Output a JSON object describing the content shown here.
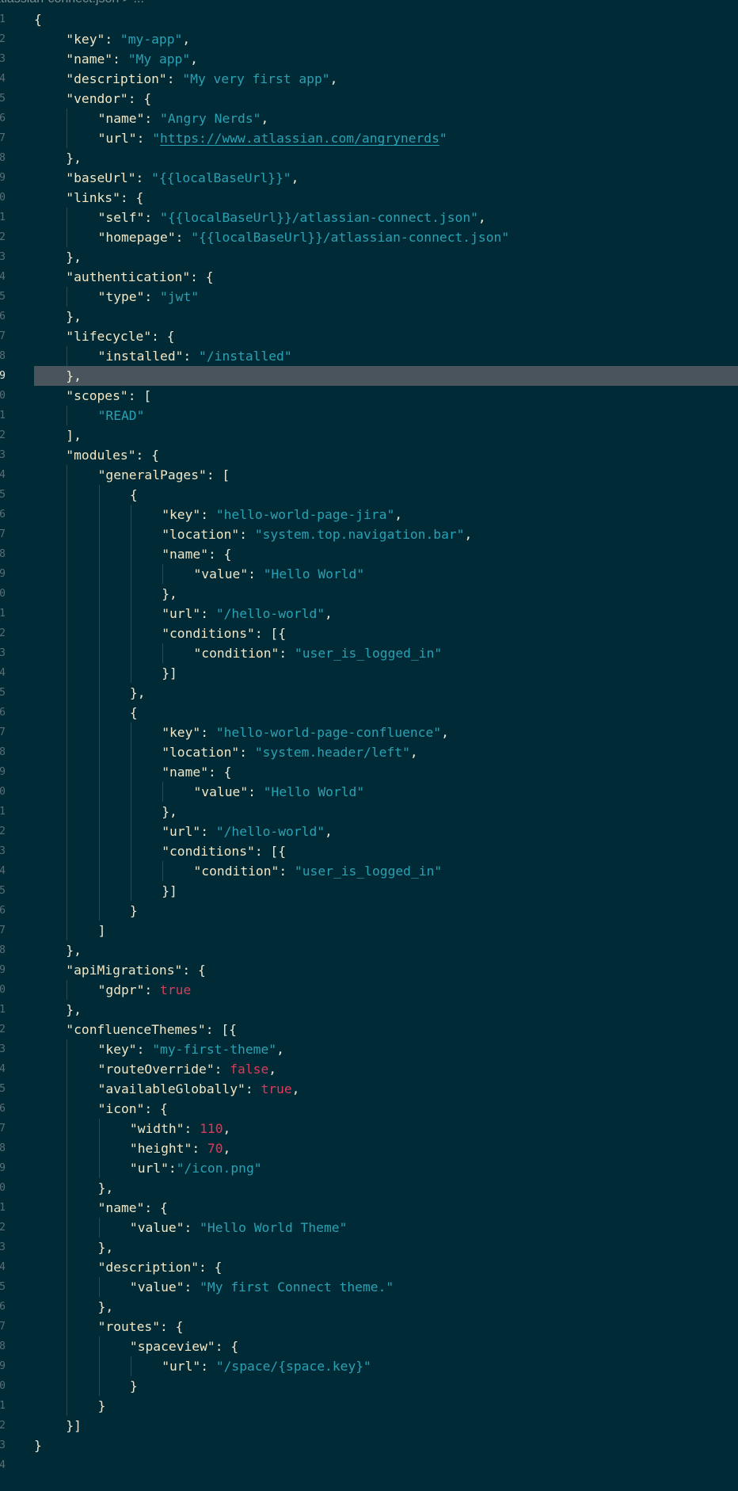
{
  "breadcrumb": "atlassian-connect.json > ...",
  "active_line": 19,
  "lines": [
    [
      [
        "p",
        "{"
      ]
    ],
    [
      [
        "k",
        "\"key\""
      ],
      [
        "p",
        ": "
      ],
      [
        "s",
        "\"my-app\""
      ],
      [
        "p",
        ","
      ]
    ],
    [
      [
        "k",
        "\"name\""
      ],
      [
        "p",
        ": "
      ],
      [
        "s",
        "\"My app\""
      ],
      [
        "p",
        ","
      ]
    ],
    [
      [
        "k",
        "\"description\""
      ],
      [
        "p",
        ": "
      ],
      [
        "s",
        "\"My very first app\""
      ],
      [
        "p",
        ","
      ]
    ],
    [
      [
        "k",
        "\"vendor\""
      ],
      [
        "p",
        ": {"
      ]
    ],
    [
      [
        "k",
        "\"name\""
      ],
      [
        "p",
        ": "
      ],
      [
        "s",
        "\"Angry Nerds\""
      ],
      [
        "p",
        ","
      ]
    ],
    [
      [
        "k",
        "\"url\""
      ],
      [
        "p",
        ": "
      ],
      [
        "s",
        "\""
      ],
      [
        "u",
        "https://www.atlassian.com/angrynerds"
      ],
      [
        "s",
        "\""
      ]
    ],
    [
      [
        "p",
        "},"
      ]
    ],
    [
      [
        "k",
        "\"baseUrl\""
      ],
      [
        "p",
        ": "
      ],
      [
        "s",
        "\"{{localBaseUrl}}\""
      ],
      [
        "p",
        ","
      ]
    ],
    [
      [
        "k",
        "\"links\""
      ],
      [
        "p",
        ": {"
      ]
    ],
    [
      [
        "k",
        "\"self\""
      ],
      [
        "p",
        ": "
      ],
      [
        "s",
        "\"{{localBaseUrl}}/atlassian-connect.json\""
      ],
      [
        "p",
        ","
      ]
    ],
    [
      [
        "k",
        "\"homepage\""
      ],
      [
        "p",
        ": "
      ],
      [
        "s",
        "\"{{localBaseUrl}}/atlassian-connect.json\""
      ]
    ],
    [
      [
        "p",
        "},"
      ]
    ],
    [
      [
        "k",
        "\"authentication\""
      ],
      [
        "p",
        ": {"
      ]
    ],
    [
      [
        "k",
        "\"type\""
      ],
      [
        "p",
        ": "
      ],
      [
        "s",
        "\"jwt\""
      ]
    ],
    [
      [
        "p",
        "},"
      ]
    ],
    [
      [
        "k",
        "\"lifecycle\""
      ],
      [
        "p",
        ": {"
      ]
    ],
    [
      [
        "k",
        "\"installed\""
      ],
      [
        "p",
        ": "
      ],
      [
        "s",
        "\"/installed\""
      ]
    ],
    [
      [
        "p",
        "},"
      ]
    ],
    [
      [
        "k",
        "\"scopes\""
      ],
      [
        "p",
        ": ["
      ]
    ],
    [
      [
        "s",
        "\"READ\""
      ]
    ],
    [
      [
        "p",
        "],"
      ]
    ],
    [
      [
        "k",
        "\"modules\""
      ],
      [
        "p",
        ": {"
      ]
    ],
    [
      [
        "k",
        "\"generalPages\""
      ],
      [
        "p",
        ": ["
      ]
    ],
    [
      [
        "p",
        "{"
      ]
    ],
    [
      [
        "k",
        "\"key\""
      ],
      [
        "p",
        ": "
      ],
      [
        "s",
        "\"hello-world-page-jira\""
      ],
      [
        "p",
        ","
      ]
    ],
    [
      [
        "k",
        "\"location\""
      ],
      [
        "p",
        ": "
      ],
      [
        "s",
        "\"system.top.navigation.bar\""
      ],
      [
        "p",
        ","
      ]
    ],
    [
      [
        "k",
        "\"name\""
      ],
      [
        "p",
        ": {"
      ]
    ],
    [
      [
        "k",
        "\"value\""
      ],
      [
        "p",
        ": "
      ],
      [
        "s",
        "\"Hello World\""
      ]
    ],
    [
      [
        "p",
        "},"
      ]
    ],
    [
      [
        "k",
        "\"url\""
      ],
      [
        "p",
        ": "
      ],
      [
        "s",
        "\"/hello-world\""
      ],
      [
        "p",
        ","
      ]
    ],
    [
      [
        "k",
        "\"conditions\""
      ],
      [
        "p",
        ": [{"
      ]
    ],
    [
      [
        "k",
        "\"condition\""
      ],
      [
        "p",
        ": "
      ],
      [
        "s",
        "\"user_is_logged_in\""
      ]
    ],
    [
      [
        "p",
        "}]"
      ]
    ],
    [
      [
        "p",
        "},"
      ]
    ],
    [
      [
        "p",
        "{"
      ]
    ],
    [
      [
        "k",
        "\"key\""
      ],
      [
        "p",
        ": "
      ],
      [
        "s",
        "\"hello-world-page-confluence\""
      ],
      [
        "p",
        ","
      ]
    ],
    [
      [
        "k",
        "\"location\""
      ],
      [
        "p",
        ": "
      ],
      [
        "s",
        "\"system.header/left\""
      ],
      [
        "p",
        ","
      ]
    ],
    [
      [
        "k",
        "\"name\""
      ],
      [
        "p",
        ": {"
      ]
    ],
    [
      [
        "k",
        "\"value\""
      ],
      [
        "p",
        ": "
      ],
      [
        "s",
        "\"Hello World\""
      ]
    ],
    [
      [
        "p",
        "},"
      ]
    ],
    [
      [
        "k",
        "\"url\""
      ],
      [
        "p",
        ": "
      ],
      [
        "s",
        "\"/hello-world\""
      ],
      [
        "p",
        ","
      ]
    ],
    [
      [
        "k",
        "\"conditions\""
      ],
      [
        "p",
        ": [{"
      ]
    ],
    [
      [
        "k",
        "\"condition\""
      ],
      [
        "p",
        ": "
      ],
      [
        "s",
        "\"user_is_logged_in\""
      ]
    ],
    [
      [
        "p",
        "}]"
      ]
    ],
    [
      [
        "p",
        "}"
      ]
    ],
    [
      [
        "p",
        "]"
      ]
    ],
    [
      [
        "p",
        "},"
      ]
    ],
    [
      [
        "k",
        "\"apiMigrations\""
      ],
      [
        "p",
        ": {"
      ]
    ],
    [
      [
        "k",
        "\"gdpr\""
      ],
      [
        "p",
        ": "
      ],
      [
        "n",
        "true"
      ]
    ],
    [
      [
        "p",
        "},"
      ]
    ],
    [
      [
        "k",
        "\"confluenceThemes\""
      ],
      [
        "p",
        ": [{"
      ]
    ],
    [
      [
        "k",
        "\"key\""
      ],
      [
        "p",
        ": "
      ],
      [
        "s",
        "\"my-first-theme\""
      ],
      [
        "p",
        ","
      ]
    ],
    [
      [
        "k",
        "\"routeOverride\""
      ],
      [
        "p",
        ": "
      ],
      [
        "n",
        "false"
      ],
      [
        "p",
        ","
      ]
    ],
    [
      [
        "k",
        "\"availableGlobally\""
      ],
      [
        "p",
        ": "
      ],
      [
        "n",
        "true"
      ],
      [
        "p",
        ","
      ]
    ],
    [
      [
        "k",
        "\"icon\""
      ],
      [
        "p",
        ": {"
      ]
    ],
    [
      [
        "k",
        "\"width\""
      ],
      [
        "p",
        ": "
      ],
      [
        "n",
        "110"
      ],
      [
        "p",
        ","
      ]
    ],
    [
      [
        "k",
        "\"height\""
      ],
      [
        "p",
        ": "
      ],
      [
        "n",
        "70"
      ],
      [
        "p",
        ","
      ]
    ],
    [
      [
        "k",
        "\"url\""
      ],
      [
        "p",
        ":"
      ],
      [
        "s",
        "\"/icon.png\""
      ]
    ],
    [
      [
        "p",
        "},"
      ]
    ],
    [
      [
        "k",
        "\"name\""
      ],
      [
        "p",
        ": {"
      ]
    ],
    [
      [
        "k",
        "\"value\""
      ],
      [
        "p",
        ": "
      ],
      [
        "s",
        "\"Hello World Theme\""
      ]
    ],
    [
      [
        "p",
        "},"
      ]
    ],
    [
      [
        "k",
        "\"description\""
      ],
      [
        "p",
        ": {"
      ]
    ],
    [
      [
        "k",
        "\"value\""
      ],
      [
        "p",
        ": "
      ],
      [
        "s",
        "\"My first Connect theme.\""
      ]
    ],
    [
      [
        "p",
        "},"
      ]
    ],
    [
      [
        "k",
        "\"routes\""
      ],
      [
        "p",
        ": {"
      ]
    ],
    [
      [
        "k",
        "\"spaceview\""
      ],
      [
        "p",
        ": {"
      ]
    ],
    [
      [
        "k",
        "\"url\""
      ],
      [
        "p",
        ": "
      ],
      [
        "s",
        "\"/space/{space.key}\""
      ]
    ],
    [
      [
        "p",
        "}"
      ]
    ],
    [
      [
        "p",
        "}"
      ]
    ],
    [
      [
        "p",
        "}]"
      ]
    ],
    [
      [
        "p",
        "}"
      ]
    ],
    []
  ],
  "line_number_digits": [
    "1",
    "2",
    "3",
    "4",
    "5",
    "6",
    "7",
    "8",
    "9",
    "0",
    "1",
    "2",
    "3",
    "4",
    "5",
    "6",
    "7",
    "8",
    "9",
    "0",
    "1",
    "2",
    "3",
    "4",
    "5",
    "6",
    "7",
    "8",
    "9",
    "0",
    "1",
    "2",
    "3",
    "4",
    "5",
    "6",
    "7",
    "8",
    "9",
    "0",
    "1",
    "2",
    "3",
    "4",
    "5",
    "6",
    "7",
    "8",
    "9",
    "0",
    "1",
    "2",
    "3",
    "4",
    "5",
    "6",
    "7",
    "8",
    "9",
    "0",
    "1",
    "2",
    "3",
    "4",
    "5",
    "6",
    "7",
    "8",
    "9",
    "0",
    "1",
    "2",
    "3",
    "4"
  ],
  "colors": {
    "background": "#002b36",
    "key": "#f2e6c5",
    "string": "#2aa1b3",
    "literal": "#dc3a5a",
    "punctuation": "#eee8d5",
    "active_line": "#49545d"
  }
}
